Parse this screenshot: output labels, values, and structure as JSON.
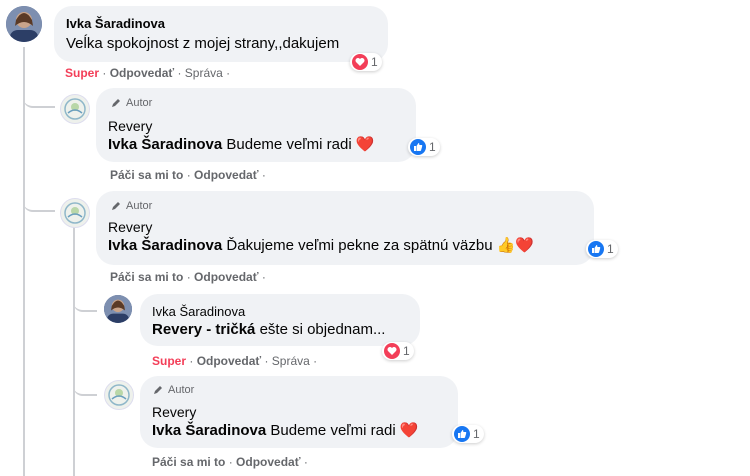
{
  "comment1": {
    "author": "Ivka Šaradinova",
    "text": "Veĺka spokojnost z mojej strany,,dakujem",
    "actions": {
      "super": "Super",
      "sep1": " · ",
      "reply": "Odpovedať",
      "sep2": " · ",
      "message": "Správa",
      "sep3": " ·"
    },
    "reaction_count": "1"
  },
  "reply1": {
    "badge": "Autor",
    "author": "Revery",
    "mention": "Ivka Šaradinova",
    "text": " Budeme veľmi radi ❤️",
    "reaction_count": "1",
    "actions": {
      "like": "Páči sa mi to",
      "sep1": " · ",
      "reply": "Odpovedať",
      "sep2": " ·"
    }
  },
  "reply2": {
    "badge": "Autor",
    "author": "Revery",
    "mention": "Ivka Šaradinova",
    "text": " Ďakujeme veľmi pekne za spätnú väzbu 👍❤️",
    "reaction_count": "1",
    "actions": {
      "like": "Páči sa mi to",
      "sep1": " · ",
      "reply": "Odpovedať",
      "sep2": " ·"
    }
  },
  "reply3": {
    "author": "Ivka Šaradinova",
    "mention": "Revery",
    "mention2": " - tričká",
    "text": " ešte si objednam...",
    "reaction_count": "1",
    "actions": {
      "super": "Super",
      "sep1": " · ",
      "reply": "Odpovedať",
      "sep2": " · ",
      "message": "Správa",
      "sep3": " ·"
    }
  },
  "reply4": {
    "badge": "Autor",
    "author": "Revery",
    "mention": "Ivka Šaradinova",
    "text": " Budeme veľmi radi ❤️",
    "reaction_count": "1",
    "actions": {
      "like": "Páči sa mi to",
      "sep1": " · ",
      "reply": "Odpovedať",
      "sep2": " ·"
    }
  },
  "colors": {
    "love": "#f33e58",
    "like": "#1877f2",
    "line": "#ced0d4"
  },
  "icons": {
    "love": "heart-icon",
    "like": "thumbs-up-icon",
    "badge": "pen-icon"
  }
}
